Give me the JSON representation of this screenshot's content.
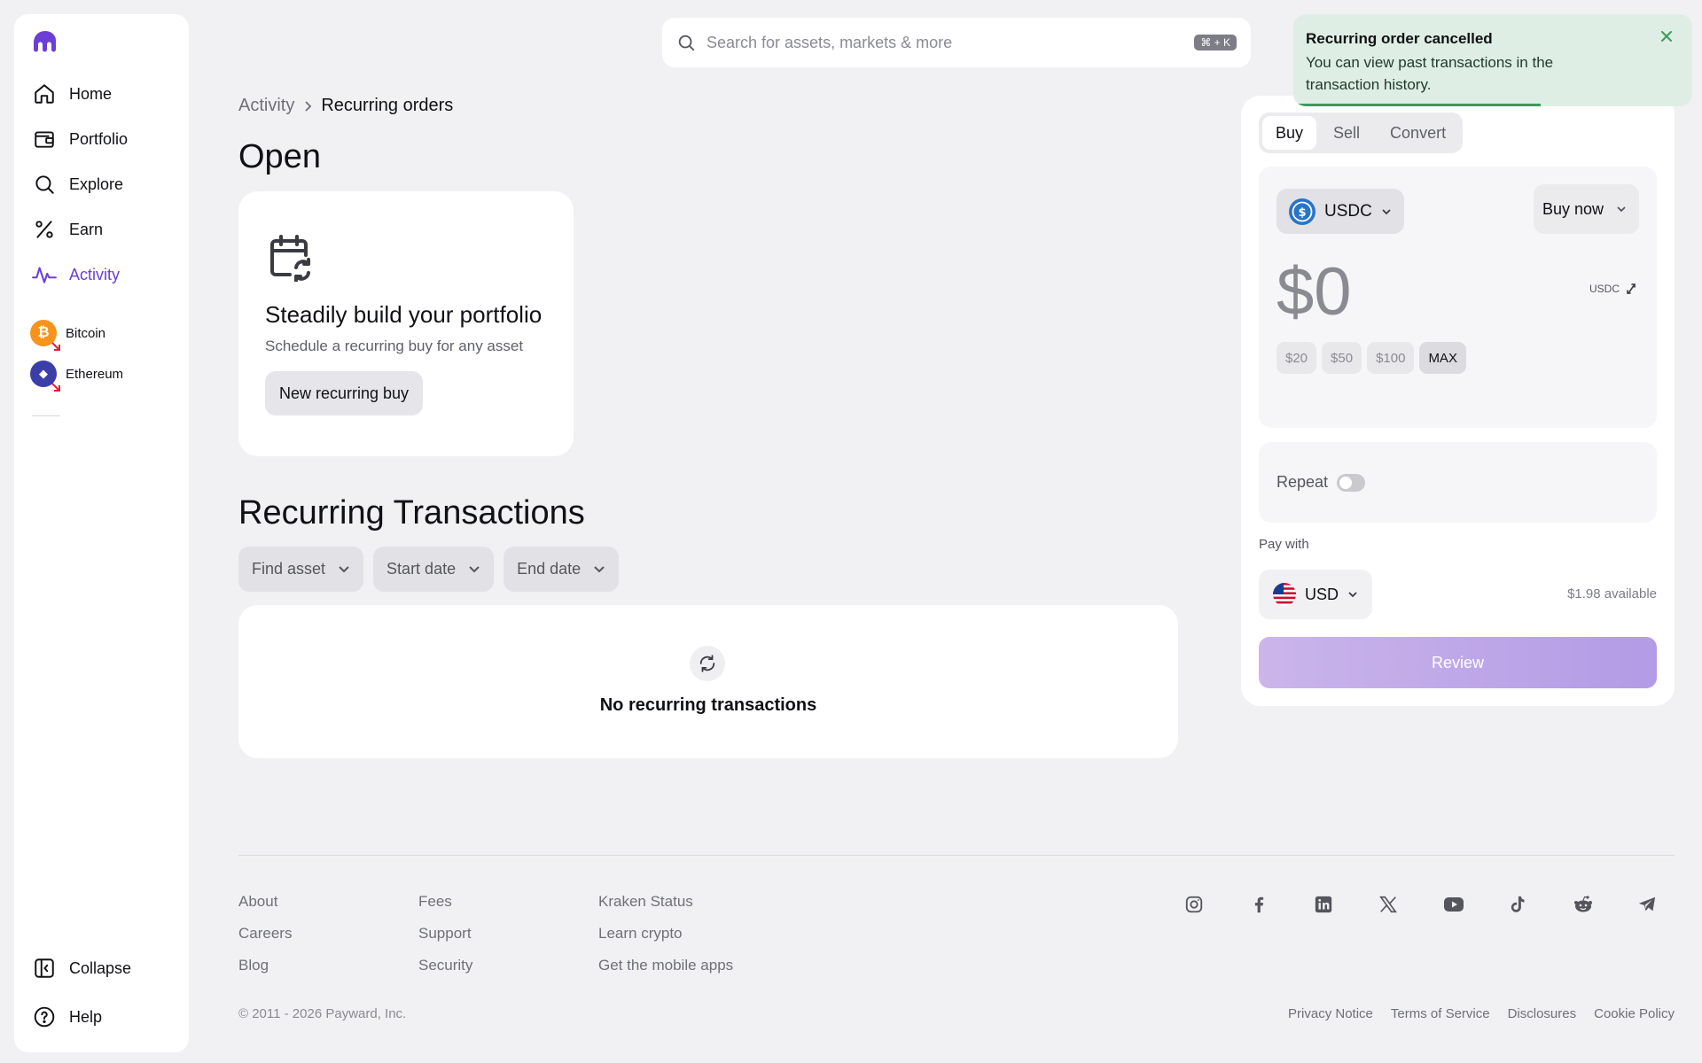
{
  "sidebar": {
    "items": [
      {
        "label": "Home",
        "icon": "home-icon"
      },
      {
        "label": "Portfolio",
        "icon": "wallet-icon"
      },
      {
        "label": "Explore",
        "icon": "search-icon"
      },
      {
        "label": "Earn",
        "icon": "percent-icon"
      },
      {
        "label": "Activity",
        "icon": "activity-icon",
        "active": true
      }
    ],
    "favorites": [
      {
        "label": "Bitcoin",
        "symbol": "₿",
        "color": "#f7931a"
      },
      {
        "label": "Ethereum",
        "symbol": "◆",
        "color": "#3b3ea8"
      }
    ],
    "collapse_label": "Collapse",
    "help_label": "Help",
    "accent_color": "#6b3fd6"
  },
  "search": {
    "placeholder": "Search for assets, markets & more",
    "shortcut": "⌘ + K"
  },
  "breadcrumb": {
    "parent": "Activity",
    "current": "Recurring orders"
  },
  "open_section": {
    "heading": "Open",
    "card_title": "Steadily build your portfolio",
    "card_subtitle": "Schedule a recurring buy for any asset",
    "button_label": "New recurring buy"
  },
  "recurring_section": {
    "heading": "Recurring Transactions",
    "filters": [
      "Find asset",
      "Start date",
      "End date"
    ],
    "empty_text": "No recurring transactions"
  },
  "trade": {
    "tabs": [
      "Buy",
      "Sell",
      "Convert"
    ],
    "selected_tab": "Buy",
    "asset": "USDC",
    "order_type": "Buy now",
    "amount": "$0",
    "unit": "USDC",
    "presets": [
      "$20",
      "$50",
      "$100",
      "MAX"
    ],
    "repeat_label": "Repeat",
    "repeat_on": false,
    "pay_with_label": "Pay with",
    "pay_currency": "USD",
    "available": "$1.98 available",
    "review_label": "Review"
  },
  "toast": {
    "title": "Recurring order cancelled",
    "body": "You can view past transactions in the transaction history.",
    "progress": 0.62
  },
  "footer": {
    "col1": [
      "About",
      "Careers",
      "Blog"
    ],
    "col2": [
      "Fees",
      "Support",
      "Security"
    ],
    "col3": [
      "Kraken Status",
      "Learn crypto",
      "Get the mobile apps"
    ],
    "socials": [
      "instagram-icon",
      "facebook-icon",
      "linkedin-icon",
      "x-icon",
      "youtube-icon",
      "tiktok-icon",
      "reddit-icon",
      "telegram-icon"
    ],
    "copyright": "© 2011 - 2026 Payward, Inc.",
    "legal": [
      "Privacy Notice",
      "Terms of Service",
      "Disclosures",
      "Cookie Policy"
    ]
  }
}
